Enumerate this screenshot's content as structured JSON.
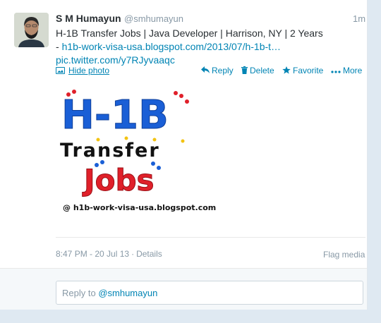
{
  "tweet": {
    "fullname": "S M Humayun",
    "username": "@smhumayun",
    "time": "1m",
    "text_main": "H-1B Transfer Jobs | Java Developer | Harrison, NY | 2 Years",
    "text_dash": "- ",
    "link_blog": "h1b-work-visa-usa.blogspot.com/2013/07/h-1b-t…",
    "link_pic": "pic.twitter.com/y7RJyvaaqc"
  },
  "actions": {
    "hide_photo": "Hide photo",
    "reply": "Reply",
    "delete": "Delete",
    "favorite": "Favorite",
    "more": "More"
  },
  "media": {
    "line1": "H-1B",
    "line2": "Transfer",
    "line3": "Jobs",
    "caption": "@ h1b-work-visa-usa.blogspot.com"
  },
  "meta": {
    "datetime": "8:47 PM - 20 Jul 13",
    "separator": "·",
    "details": "Details",
    "flag_media": "Flag media"
  },
  "reply_box": {
    "prefix": "Reply to ",
    "handle": "@smhumayun"
  },
  "colors": {
    "link": "#0084b4",
    "muted": "#8899a6",
    "media_blue": "#1a5fd6",
    "media_red": "#e0202a",
    "media_yellow": "#f2c312"
  }
}
